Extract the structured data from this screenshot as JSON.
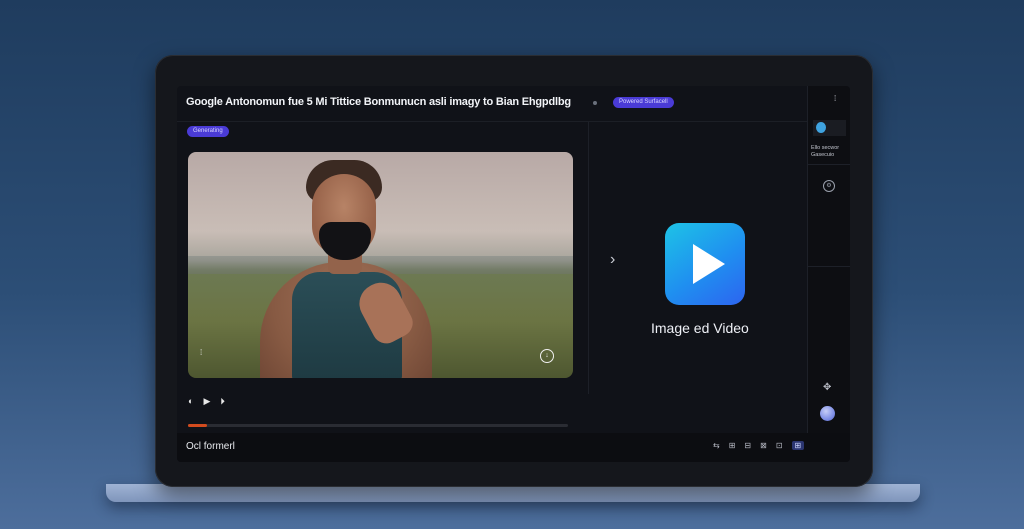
{
  "header": {
    "title": "Google Antonomun fue 5 Mi Tittice Bonmunucn asli imagy to Bian Ehgpdlbg",
    "badge": "Powered Surfacell"
  },
  "tag": "Generating",
  "video": {
    "corner_left": "⁞",
    "corner_right": "↓"
  },
  "controls": {
    "buttons": [
      "◐",
      "▶",
      "⏵"
    ],
    "progress_percent": 5
  },
  "footer": {
    "label": "Ocl formerl",
    "tools": [
      "⇆",
      "⊞",
      "⊟",
      "⊠",
      "⊡",
      "⊞"
    ]
  },
  "preview": {
    "label": "Image ed Video"
  },
  "sidebar": {
    "menu_glyph": "⁞",
    "label": "Ello secwor Gasecuio"
  },
  "colors": {
    "accent": "#4a3bd6",
    "progress": "#d24b1e",
    "app_icon_start": "#1ec3e6",
    "app_icon_end": "#2d64f0"
  }
}
